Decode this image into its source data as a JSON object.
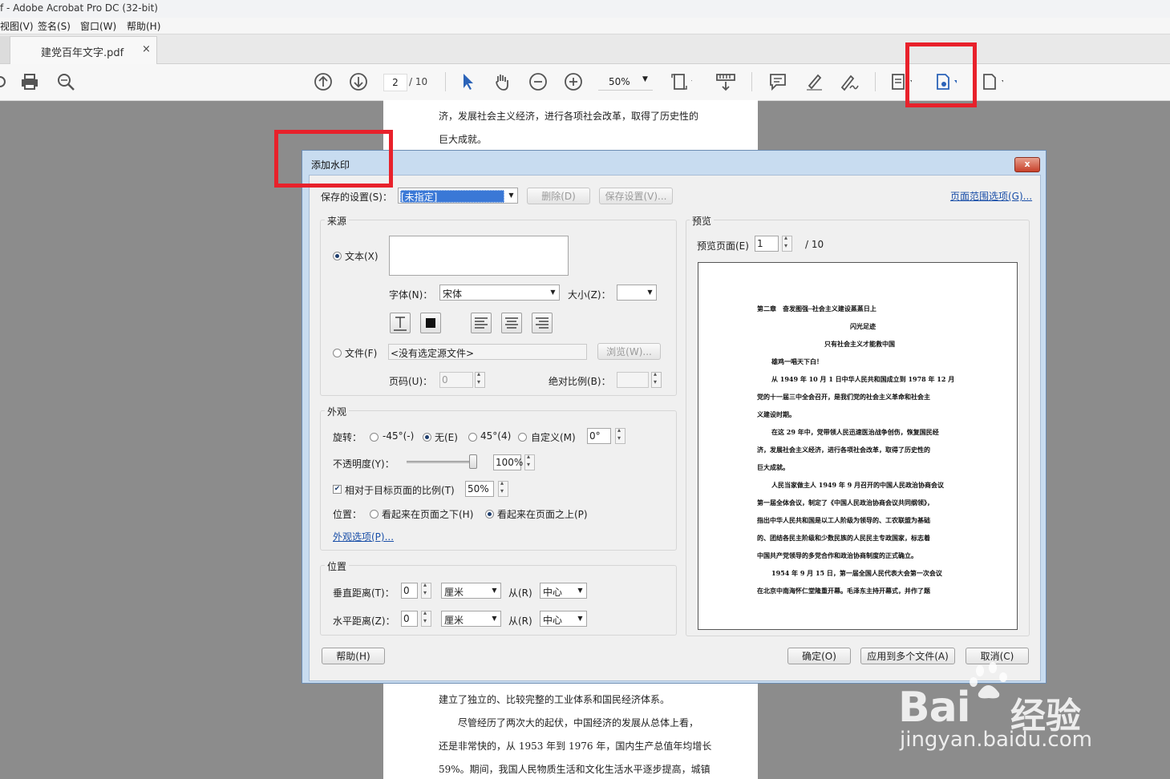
{
  "window": {
    "title": "f - Adobe Acrobat Pro DC (32-bit)"
  },
  "menu": [
    "视图(V)",
    "签名(S)",
    "窗口(W)",
    "帮助(H)"
  ],
  "tab": {
    "label": "建党百年文字.pdf",
    "close": "×"
  },
  "toolbar": {
    "page_current": "2",
    "page_total": "/ 10",
    "zoom": "50%"
  },
  "background_page": {
    "top_lines": [
      "济，发展社会主义经济，进行各项社会改革，取得了历史性的",
      "巨大成就。"
    ],
    "bottom_lines": [
      "建立了独立的、比较完整的工业体系和国民经济体系。",
      "尽管经历了两次大的起伏，中国经济的发展从总体上看，",
      "还是非常快的，从 1953 年到 1976 年，国内生产总值年均增长",
      "59%。期间，我国人民物质生活和文化生活水平逐步提高，城镇"
    ]
  },
  "dialog": {
    "title": "添加水印",
    "close": "x",
    "saved_settings_label": "保存的设置(S)：",
    "saved_settings_value": "[未指定]",
    "delete_btn": "删除(D)",
    "save_settings_btn": "保存设置(V)...",
    "page_range_link": "页面范围选项(G)...",
    "source": {
      "title": "来源",
      "text_radio": "文本(X)",
      "font_label": "字体(N)：",
      "font_value": "宋体",
      "size_label": "大小(Z)：",
      "file_radio": "文件(F)",
      "file_value": "<没有选定源文件>",
      "browse_btn": "浏览(W)...",
      "page_label": "页码(U)：",
      "page_value": "0",
      "abs_scale_label": "绝对比例(B)："
    },
    "appearance": {
      "title": "外观",
      "rotation_label": "旋转：",
      "rot_m45": "-45°(-)",
      "rot_none": "无(E)",
      "rot_45": "45°(4)",
      "rot_custom": "自定义(M)",
      "rot_value": "0°",
      "opacity_label": "不透明度(Y)：",
      "opacity_value": "100%",
      "opacity_level": 1.0,
      "relative_scale_label": "相对于目标页面的比例(T)",
      "relative_scale_value": "50%",
      "position_label": "位置：",
      "pos_behind": "看起来在页面之下(H)",
      "pos_front": "看起来在页面之上(P)",
      "appearance_options_link": "外观选项(P)..."
    },
    "position": {
      "title": "位置",
      "vertical_label": "垂直距离(T)：",
      "vertical_value": "0",
      "vertical_unit": "厘米",
      "from_label": "从(R)",
      "vertical_from": "中心",
      "horizontal_label": "水平距离(Z)：",
      "horizontal_value": "0",
      "horizontal_unit": "厘米",
      "horizontal_from": "中心"
    },
    "preview": {
      "title": "预览",
      "page_label": "预览页面(E)",
      "page_value": "1",
      "page_total": "/ 10",
      "lines": [
        "第二章　奋发图强─社会主义建设蒸蒸日上",
        "闪光足迹",
        "只有社会主义才能救中国",
        "雄鸡一唱天下白！",
        "从 1949 年 10 月 1 日中华人民共和国成立到 1978 年 12 月",
        "党的十一届三中全会召开，是我们党的社会主义革命和社会主",
        "义建设时期。",
        "在这 29 年中，党带领人民迅速医治战争创伤，恢复国民经",
        "济，发展社会主义经济，进行各项社会改革，取得了历史性的",
        "巨大成就。",
        "人民当家做主人 1949 年 9 月召开的中国人民政治协商会议",
        "第一届全体会议，制定了《中国人民政治协商会议共同纲领》，",
        "指出中华人民共和国是以工人阶级为领导的、工农联盟为基础",
        "的、团结各民主阶级和少数民族的人民民主专政国家，标志着",
        "中国共产党领导的多党合作和政治协商制度的正式确立。",
        "1954 年 9 月 15 日，第一届全国人民代表大会第一次会议",
        "在北京中南海怀仁堂隆重开幕。毛泽东主持开幕式，并作了题"
      ]
    },
    "help_btn": "帮助(H)",
    "ok_btn": "确定(O)",
    "apply_multi_btn": "应用到多个文件(A)",
    "cancel_btn": "取消(C)"
  },
  "watermark": {
    "brand": "Bai",
    "brand2": "经验",
    "url": "jingyan.baidu.com"
  }
}
